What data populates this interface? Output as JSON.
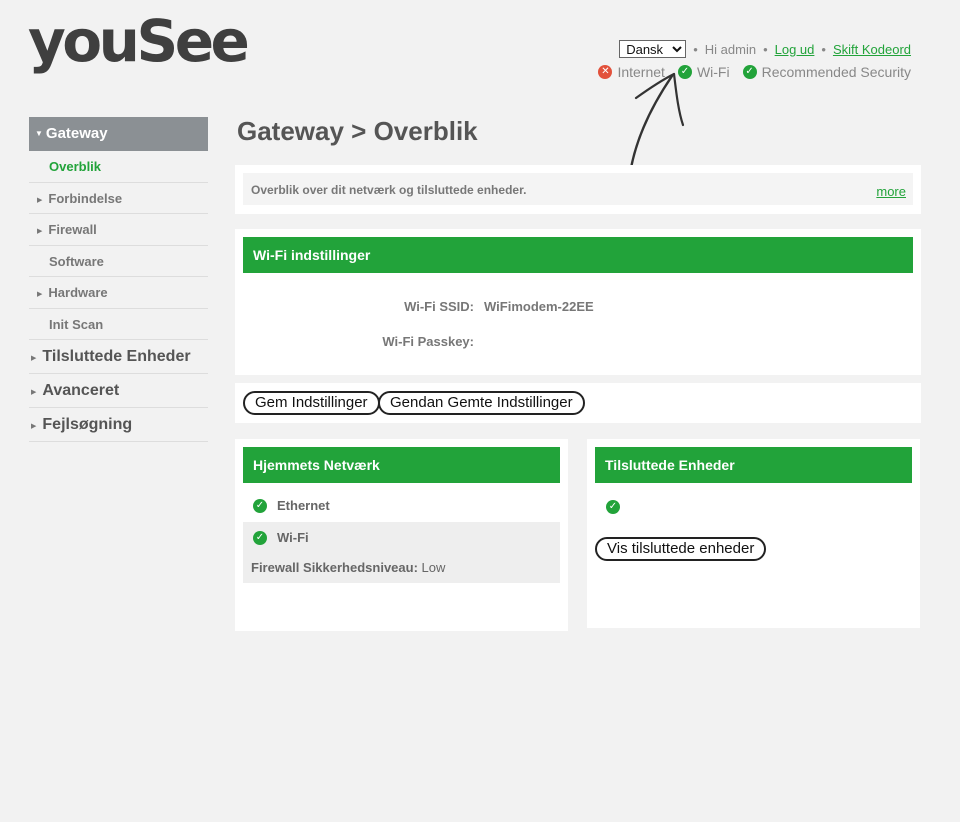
{
  "brand": {
    "logo_text": "youSee"
  },
  "header": {
    "language": {
      "selected": "Dansk"
    },
    "greeting": "Hi admin",
    "logout": "Log ud",
    "change_password": "Skift Kodeord"
  },
  "status": {
    "internet": {
      "label": "Internet",
      "state": "error",
      "icon": "x-circle-icon"
    },
    "wifi": {
      "label": "Wi-Fi",
      "state": "ok",
      "icon": "check-circle-icon"
    },
    "security": {
      "label": "Recommended Security",
      "state": "ok",
      "icon": "check-circle-icon"
    }
  },
  "sidebar": {
    "section": "Gateway",
    "sub_items": [
      {
        "label": "Overblik",
        "active": true,
        "expandable": false
      },
      {
        "label": "Forbindelse",
        "active": false,
        "expandable": true
      },
      {
        "label": "Firewall",
        "active": false,
        "expandable": true
      },
      {
        "label": "Software",
        "active": false,
        "expandable": false
      },
      {
        "label": "Hardware",
        "active": false,
        "expandable": true
      },
      {
        "label": "Init Scan",
        "active": false,
        "expandable": false
      }
    ],
    "top_items": [
      {
        "label": "Tilsluttede Enheder"
      },
      {
        "label": "Avanceret"
      },
      {
        "label": "Fejlsøgning"
      }
    ]
  },
  "page": {
    "title": "Gateway > Overblik",
    "description": "Overblik over dit netværk og tilsluttede enheder.",
    "more_link": "more"
  },
  "wifi_settings": {
    "title": "Wi-Fi indstillinger",
    "ssid_label": "Wi-Fi SSID:",
    "ssid_value": "WiFimodem-22EE",
    "passkey_label": "Wi-Fi Passkey:",
    "passkey_value": ""
  },
  "actions": {
    "save": "Gem Indstillinger",
    "restore": "Gendan Gemte Indstillinger"
  },
  "home_network": {
    "title": "Hjemmets Netværk",
    "items": [
      {
        "label": "Ethernet",
        "state": "ok"
      },
      {
        "label": "Wi-Fi",
        "state": "ok"
      }
    ],
    "firewall_label": "Firewall Sikkerhedsniveau:",
    "firewall_value": "Low"
  },
  "connected_devices": {
    "title": "Tilsluttede Enheder",
    "show_button": "Vis tilsluttede enheder"
  },
  "colors": {
    "accent": "#22a33a",
    "error": "#e2513b",
    "nav_head": "#8b9094"
  }
}
